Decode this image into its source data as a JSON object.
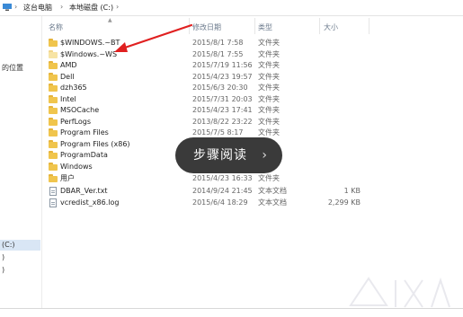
{
  "address_bar": {
    "crumbs": [
      "这台电脑",
      "本地磁盘 (C:)"
    ],
    "separator": "›"
  },
  "nav_pane": {
    "items": [
      "的位置",
      "(C:)",
      ")",
      ")"
    ],
    "selected_index": 1
  },
  "columns": {
    "name": "名称",
    "date": "修改日期",
    "type": "类型",
    "size": "大小"
  },
  "files": [
    {
      "icon": "folder-icon",
      "hidden": false,
      "name": "$WINDOWS.~BT",
      "date": "2015/8/1 7:58",
      "type": "文件夹",
      "size": ""
    },
    {
      "icon": "folder-icon",
      "hidden": true,
      "name": "$Windows.~WS",
      "date": "2015/8/1 7:55",
      "type": "文件夹",
      "size": ""
    },
    {
      "icon": "folder-icon",
      "hidden": false,
      "name": "AMD",
      "date": "2015/7/19 11:56",
      "type": "文件夹",
      "size": ""
    },
    {
      "icon": "folder-icon",
      "hidden": false,
      "name": "Dell",
      "date": "2015/4/23 19:57",
      "type": "文件夹",
      "size": ""
    },
    {
      "icon": "folder-icon",
      "hidden": false,
      "name": "dzh365",
      "date": "2015/6/3 20:30",
      "type": "文件夹",
      "size": ""
    },
    {
      "icon": "folder-icon",
      "hidden": false,
      "name": "Intel",
      "date": "2015/7/31 20:03",
      "type": "文件夹",
      "size": ""
    },
    {
      "icon": "folder-icon",
      "hidden": false,
      "name": "MSOCache",
      "date": "2015/4/23 17:41",
      "type": "文件夹",
      "size": ""
    },
    {
      "icon": "folder-icon",
      "hidden": false,
      "name": "PerfLogs",
      "date": "2013/8/22 23:22",
      "type": "文件夹",
      "size": ""
    },
    {
      "icon": "folder-icon",
      "hidden": false,
      "name": "Program Files",
      "date": "2015/7/5 8:17",
      "type": "文件夹",
      "size": ""
    },
    {
      "icon": "folder-icon",
      "hidden": false,
      "name": "Program Files (x86)",
      "date": "",
      "type": "",
      "size": ""
    },
    {
      "icon": "folder-icon",
      "hidden": false,
      "name": "ProgramData",
      "date": "",
      "type": "",
      "size": ""
    },
    {
      "icon": "folder-icon",
      "hidden": false,
      "name": "Windows",
      "date": "",
      "type": "",
      "size": ""
    },
    {
      "icon": "folder-icon",
      "hidden": false,
      "name": "用户",
      "date": "2015/4/23 16:33",
      "type": "文件夹",
      "size": ""
    },
    {
      "icon": "file-icon",
      "hidden": false,
      "name": "DBAR_Ver.txt",
      "date": "2014/9/24 21:45",
      "type": "文本文档",
      "size": "1 KB"
    },
    {
      "icon": "file-icon",
      "hidden": false,
      "name": "vcredist_x86.log",
      "date": "2015/6/4 18:29",
      "type": "文本文档",
      "size": "2,299 KB"
    }
  ],
  "overlay": {
    "label": "步骤阅读",
    "chevron": "›"
  },
  "colors": {
    "folder": "#f0c54d",
    "annotation_arrow": "#e02020",
    "overlay_bg": "#3a3a3a",
    "selection": "#d9e6f5"
  }
}
